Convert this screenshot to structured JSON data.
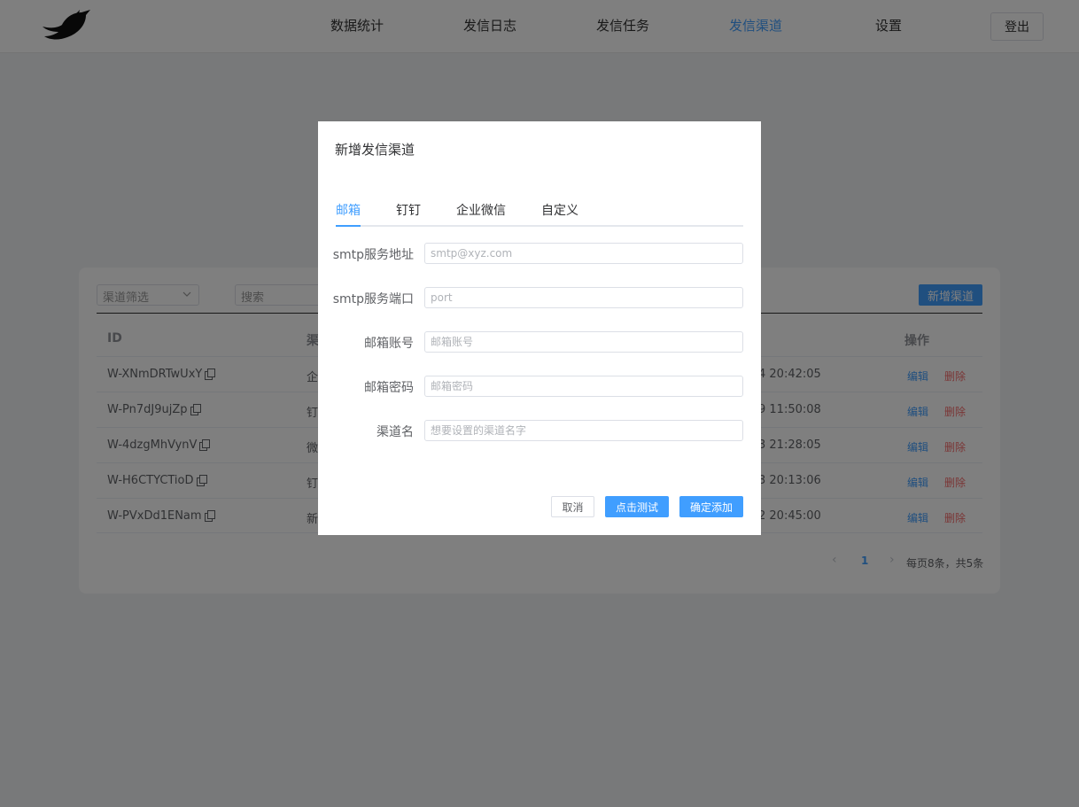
{
  "header": {
    "nav": [
      "数据统计",
      "发信日志",
      "发信任务",
      "发信渠道",
      "设置"
    ],
    "active_index": 3,
    "logout_label": "登出"
  },
  "list": {
    "filter_placeholder": "渠道筛选",
    "search_placeholder": "搜索",
    "add_label": "新增渠道",
    "columns": {
      "id": "ID",
      "name": "渠",
      "action": "操作"
    },
    "rows": [
      {
        "id": "W-XNmDRTwUxY",
        "name": "企",
        "time": "4 20:42:05"
      },
      {
        "id": "W-Pn7dJ9ujZp",
        "name": "钉",
        "time": "9 11:50:08"
      },
      {
        "id": "W-4dzgMhVynV",
        "name": "微",
        "time": "3 21:28:05"
      },
      {
        "id": "W-H6CTYCTioD",
        "name": "钉",
        "time": "3 20:13:06"
      },
      {
        "id": "W-PVxDd1ENam",
        "name": "新",
        "time": "2 20:45:00"
      }
    ],
    "edit_label": "编辑",
    "delete_label": "删除",
    "pager": {
      "prev": "‹",
      "page": "1",
      "next": "›",
      "summary": "每页8条，共5条"
    }
  },
  "dialog": {
    "title": "新增发信渠道",
    "tabs": [
      "邮箱",
      "钉钉",
      "企业微信",
      "自定义"
    ],
    "active_tab": 0,
    "fields": [
      {
        "label": "smtp服务地址",
        "placeholder": "smtp@xyz.com"
      },
      {
        "label": "smtp服务端口",
        "placeholder": "port"
      },
      {
        "label": "邮箱账号",
        "placeholder": "邮箱账号"
      },
      {
        "label": "邮箱密码",
        "placeholder": "邮箱密码"
      },
      {
        "label": "渠道名",
        "placeholder": "想要设置的渠道名字"
      }
    ],
    "cancel_label": "取消",
    "test_label": "点击测试",
    "confirm_label": "确定添加"
  },
  "colors": {
    "accent": "#409eff",
    "danger": "#f56c6c"
  }
}
